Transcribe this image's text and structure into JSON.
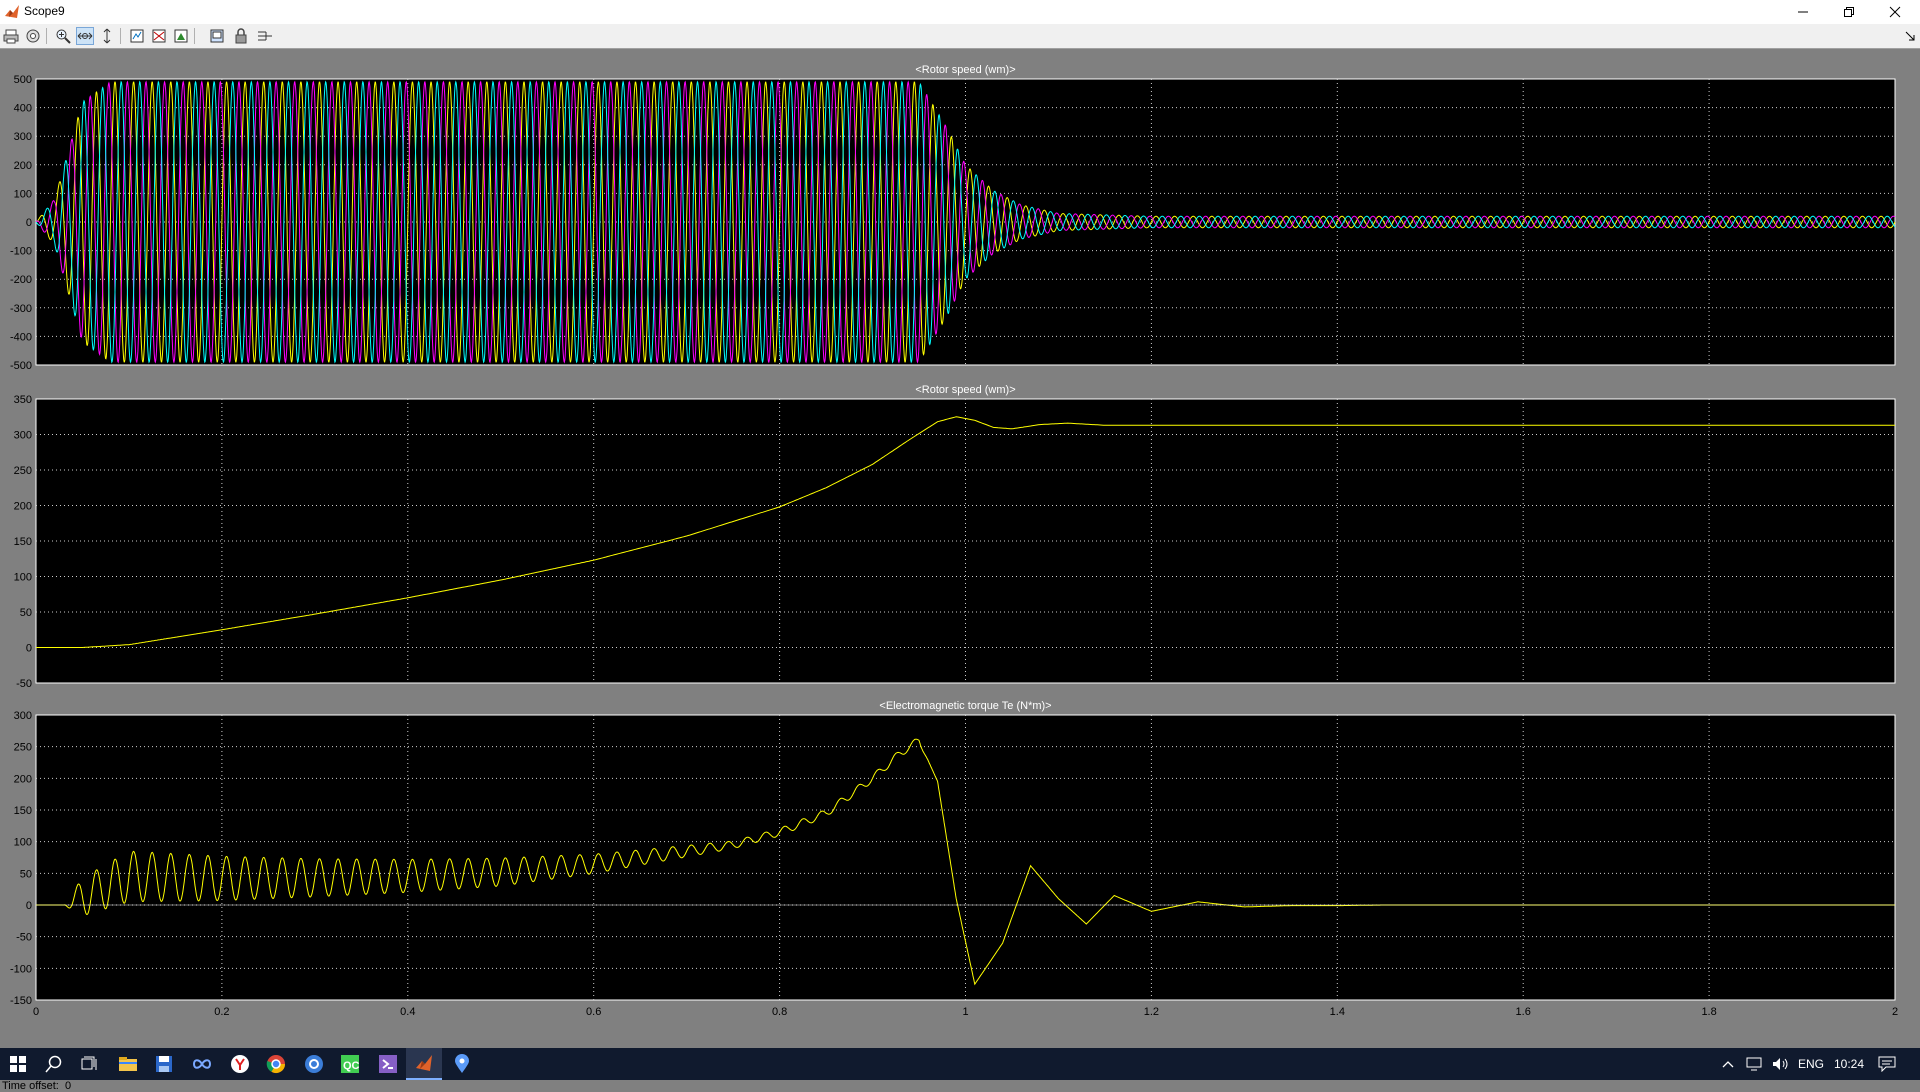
{
  "window": {
    "title": "Scope9",
    "controls": [
      "minimize",
      "restore",
      "close"
    ]
  },
  "toolbar": {
    "buttons": [
      {
        "name": "print-icon"
      },
      {
        "name": "parameters-icon"
      },
      {
        "name": "zoom-in-icon"
      },
      {
        "name": "zoom-x-icon",
        "active": true
      },
      {
        "name": "zoom-y-icon"
      },
      {
        "name": "autoscale-icon"
      },
      {
        "name": "save-axes-icon"
      },
      {
        "name": "restore-axes-icon"
      },
      {
        "name": "floating-scope-icon"
      },
      {
        "name": "lock-axes-icon"
      },
      {
        "name": "signal-selection-icon"
      }
    ]
  },
  "chart_data": [
    {
      "type": "line",
      "title": "<Rotor speed (wm)>",
      "xlim": [
        0,
        2
      ],
      "ylim": [
        -500,
        500
      ],
      "yticks": [
        "500",
        "400",
        "300",
        "200",
        "100",
        "0",
        "-100",
        "-200",
        "-300",
        "-400",
        "-500"
      ],
      "xticks": [
        "0",
        "0.2",
        "0.4",
        "0.6",
        "0.8",
        "1",
        "1.2",
        "1.4",
        "1.6",
        "1.8",
        "2"
      ],
      "grid": true,
      "series": [
        {
          "color": "#ffff00",
          "phase_deg": 0
        },
        {
          "color": "#ff00ff",
          "phase_deg": 120
        },
        {
          "color": "#00ffff",
          "phase_deg": 240
        }
      ],
      "envelope": {
        "x": [
          0,
          0.02,
          0.05,
          0.08,
          0.95,
          0.98,
          1.0,
          1.03,
          1.06,
          1.1,
          1.2,
          2.0
        ],
        "amp": [
          0,
          80,
          420,
          490,
          490,
          330,
          200,
          110,
          60,
          30,
          20,
          20
        ]
      },
      "frequency_hz": 50
    },
    {
      "type": "line",
      "title": "<Rotor speed (wm)>",
      "xlim": [
        0,
        2
      ],
      "ylim": [
        -50,
        350
      ],
      "yticks": [
        "350",
        "300",
        "250",
        "200",
        "150",
        "100",
        "50",
        "0",
        "-50"
      ],
      "xticks": [
        "0",
        "0.2",
        "0.4",
        "0.6",
        "0.8",
        "1",
        "1.2",
        "1.4",
        "1.6",
        "1.8",
        "2"
      ],
      "grid": true,
      "series": [
        {
          "color": "#ffff00",
          "x": [
            0,
            0.05,
            0.1,
            0.2,
            0.3,
            0.4,
            0.5,
            0.6,
            0.7,
            0.8,
            0.85,
            0.9,
            0.94,
            0.97,
            0.99,
            1.01,
            1.03,
            1.05,
            1.08,
            1.11,
            1.15,
            1.2,
            1.4,
            2.0
          ],
          "y": [
            0,
            0,
            4,
            25,
            47,
            70,
            95,
            123,
            157,
            198,
            225,
            258,
            293,
            318,
            325,
            320,
            310,
            308,
            314,
            316,
            313,
            313,
            313,
            313
          ]
        }
      ]
    },
    {
      "type": "line",
      "title": "<Electromagnetic torque Te (N*m)>",
      "xlim": [
        0,
        2
      ],
      "ylim": [
        -150,
        300
      ],
      "yticks": [
        "300",
        "250",
        "200",
        "150",
        "100",
        "50",
        "0",
        "-50",
        "-100",
        "-150"
      ],
      "xticks": [
        "0",
        "0.2",
        "0.4",
        "0.6",
        "0.8",
        "1",
        "1.2",
        "1.4",
        "1.6",
        "1.8",
        "2"
      ],
      "grid": true,
      "series": [
        {
          "color": "#ffff00",
          "x": [
            0,
            0.03,
            0.1,
            0.2,
            0.3,
            0.4,
            0.5,
            0.6,
            0.7,
            0.75,
            0.8,
            0.85,
            0.9,
            0.93,
            0.95,
            0.97,
            0.99,
            1.01,
            1.04,
            1.07,
            1.1,
            1.13,
            1.16,
            1.2,
            1.25,
            1.3,
            1.35,
            1.4,
            1.45,
            2.0
          ],
          "y": [
            0,
            0,
            45,
            42,
            43,
            46,
            52,
            65,
            85,
            95,
            115,
            145,
            200,
            240,
            260,
            195,
            10,
            -125,
            -60,
            62,
            10,
            -30,
            15,
            -10,
            5,
            -3,
            -1,
            -1,
            0,
            0
          ],
          "ripple": {
            "x": [
              0,
              0.03,
              0.05,
              0.1,
              0.3,
              0.5,
              0.65,
              0.75,
              0.85,
              0.95,
              0.96,
              2.0
            ],
            "amp": [
              0,
              0,
              30,
              40,
              30,
              22,
              12,
              6,
              6,
              6,
              0,
              0
            ],
            "frequency_hz": 50
          }
        }
      ]
    }
  ],
  "status": {
    "label": "Time offset:",
    "value": "0"
  },
  "taskbar": {
    "apps": [
      {
        "name": "windows-start-icon"
      },
      {
        "name": "search-icon"
      },
      {
        "name": "task-view-icon"
      },
      {
        "name": "file-explorer-icon"
      },
      {
        "name": "save-disk-icon"
      },
      {
        "name": "infinity-app-icon"
      },
      {
        "name": "yandex-browser-icon"
      },
      {
        "name": "chrome-icon"
      },
      {
        "name": "blue-circle-app-icon"
      },
      {
        "name": "qc-app-icon"
      },
      {
        "name": "visual-studio-icon"
      },
      {
        "name": "matlab-icon",
        "active": true
      },
      {
        "name": "maps-pin-icon"
      }
    ],
    "tray": {
      "language": "ENG",
      "time": "10:24"
    }
  }
}
